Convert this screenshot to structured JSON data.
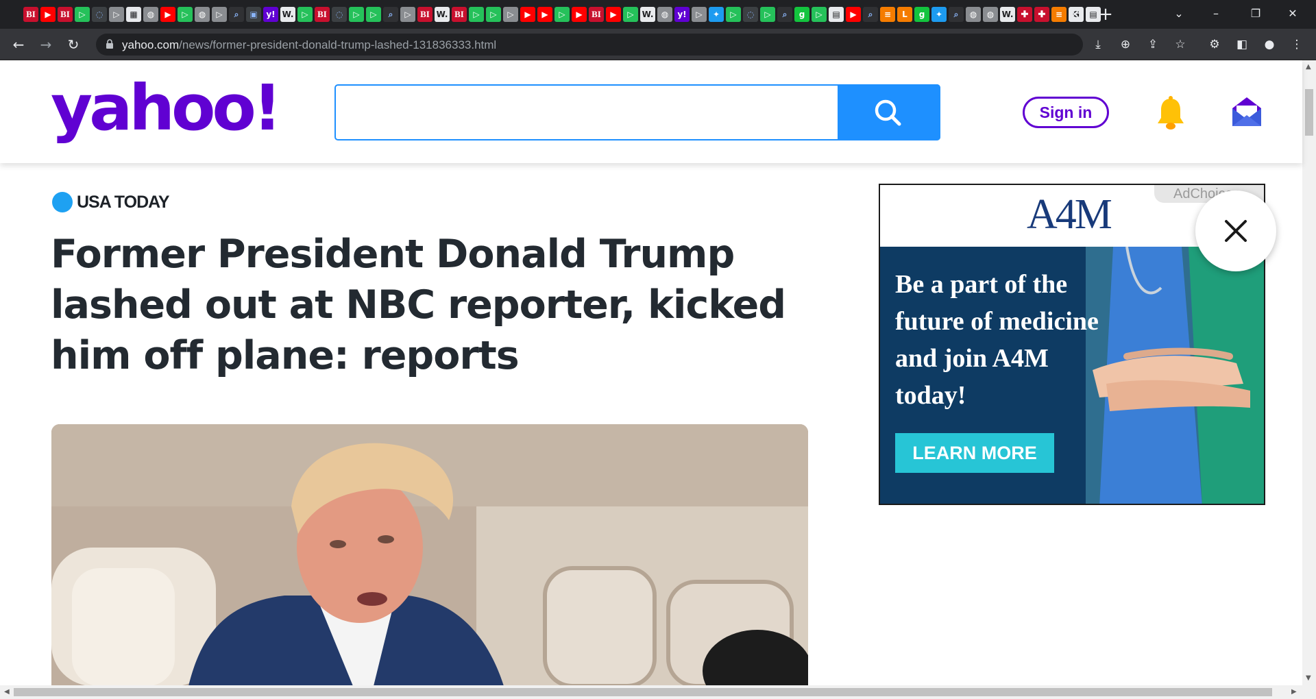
{
  "browser": {
    "tabs": [
      {
        "icon": "business-insider-icon",
        "label": "BI"
      },
      {
        "icon": "youtube-icon",
        "label": "▶"
      },
      {
        "icon": "business-insider-icon",
        "label": "BI"
      },
      {
        "icon": "play-icon",
        "label": "▷"
      },
      {
        "icon": "shield-icon",
        "label": "◌"
      },
      {
        "icon": "forward-icon",
        "label": "▷"
      },
      {
        "icon": "puzzle-icon",
        "label": "▦"
      },
      {
        "icon": "globe-icon",
        "label": "◍"
      },
      {
        "icon": "youtube-icon",
        "label": "▶"
      },
      {
        "icon": "play-icon",
        "label": "▷"
      },
      {
        "icon": "globe-icon",
        "label": "◍"
      },
      {
        "icon": "forward-icon",
        "label": "▷"
      },
      {
        "icon": "search-icon",
        "label": "⌕"
      },
      {
        "icon": "shield-icon",
        "label": "▣"
      },
      {
        "icon": "yahoo-icon",
        "label": "y!"
      },
      {
        "icon": "wsj-icon",
        "label": "W."
      },
      {
        "icon": "play-icon",
        "label": "▷"
      },
      {
        "icon": "business-insider-icon",
        "label": "BI"
      },
      {
        "icon": "shield-icon",
        "label": "◌"
      },
      {
        "icon": "play-icon",
        "label": "▷"
      },
      {
        "icon": "play-icon",
        "label": "▷"
      },
      {
        "icon": "search-icon",
        "label": "⌕"
      },
      {
        "icon": "forward-icon",
        "label": "▷"
      },
      {
        "icon": "business-insider-icon",
        "label": "BI"
      },
      {
        "icon": "wsj-icon",
        "label": "W."
      },
      {
        "icon": "business-insider-icon",
        "label": "BI"
      },
      {
        "icon": "play-icon",
        "label": "▷"
      },
      {
        "icon": "play-icon",
        "label": "▷"
      },
      {
        "icon": "forward-icon",
        "label": "▷"
      },
      {
        "icon": "youtube-icon",
        "label": "▶"
      },
      {
        "icon": "youtube-icon",
        "label": "▶"
      },
      {
        "icon": "play-icon",
        "label": "▷"
      },
      {
        "icon": "youtube-icon",
        "label": "▶"
      },
      {
        "icon": "business-insider-icon",
        "label": "BI"
      },
      {
        "icon": "youtube-icon",
        "label": "▶"
      },
      {
        "icon": "play-icon",
        "label": "▷"
      },
      {
        "icon": "wsj-icon",
        "label": "W."
      },
      {
        "icon": "globe-icon",
        "label": "◍"
      },
      {
        "icon": "yahoo-icon",
        "label": "y!"
      },
      {
        "icon": "forward-icon",
        "label": "▷"
      },
      {
        "icon": "twitter-icon",
        "label": "✦"
      },
      {
        "icon": "play-icon",
        "label": "▷"
      },
      {
        "icon": "shield-icon",
        "label": "◌"
      },
      {
        "icon": "play-icon",
        "label": "▷"
      },
      {
        "icon": "search-icon",
        "label": "⌕"
      },
      {
        "icon": "g-icon",
        "label": "g"
      },
      {
        "icon": "play-icon",
        "label": "▷"
      },
      {
        "icon": "news-icon",
        "label": "▤"
      },
      {
        "icon": "youtube-icon",
        "label": "▶"
      },
      {
        "icon": "search-icon",
        "label": "⌕"
      },
      {
        "icon": "bookmark-icon",
        "label": "≡"
      },
      {
        "icon": "latimes-icon",
        "label": "L"
      },
      {
        "icon": "g-icon",
        "label": "g"
      },
      {
        "icon": "twitter-icon",
        "label": "✦"
      },
      {
        "icon": "search-icon",
        "label": "⌕"
      },
      {
        "icon": "globe-icon",
        "label": "◍"
      },
      {
        "icon": "globe-icon",
        "label": "◍"
      },
      {
        "icon": "wsj-icon",
        "label": "W."
      },
      {
        "icon": "alert-icon",
        "label": "✚"
      },
      {
        "icon": "alert-icon",
        "label": "✚"
      },
      {
        "icon": "bookmark-icon",
        "label": "≡"
      },
      {
        "icon": "google-icon",
        "label": "G"
      },
      {
        "icon": "doc-icon",
        "label": "▤"
      }
    ],
    "new_tab": "+",
    "url_domain": "yahoo.com",
    "url_path": "/news/former-president-donald-trump-lashed-131836333.html"
  },
  "header": {
    "logo": "yahoo!",
    "search_placeholder": "",
    "signin_label": "Sign in"
  },
  "article": {
    "source": "USA TODAY",
    "headline": "Former President Donald Trump lashed out at NBC reporter, kicked him off plane: reports"
  },
  "ad": {
    "adchoices": "AdChoices",
    "brand": "A4M",
    "tagline": "Be a part of the future of medicine and join A4M today!",
    "cta": "LEARN MORE"
  },
  "colors": {
    "yahoo_purple": "#6001d2",
    "search_blue": "#1e90ff",
    "ad_navy": "#0e3b63",
    "ad_cta": "#27c5d6"
  }
}
